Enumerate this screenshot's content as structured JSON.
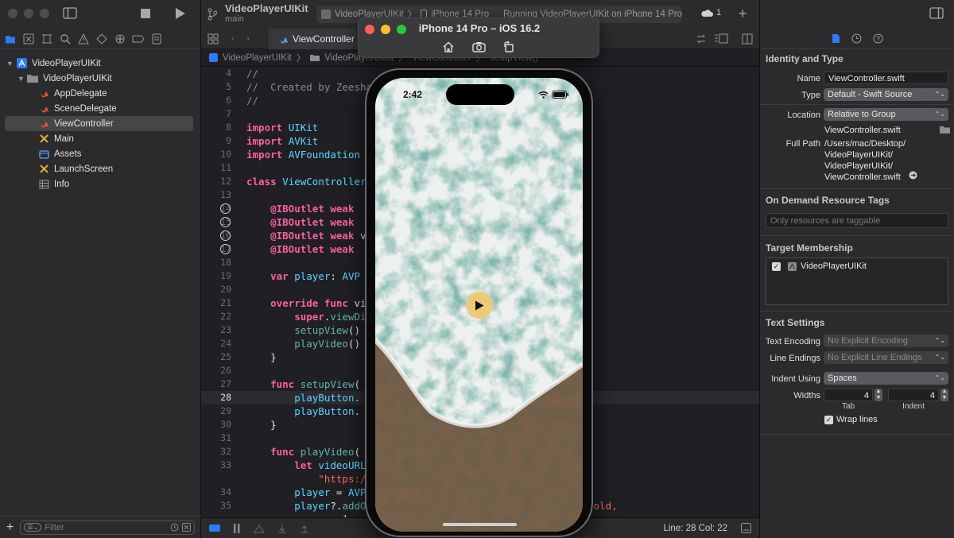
{
  "project": {
    "name": "VideoPlayerUIKit",
    "branch": "main"
  },
  "toolbar": {
    "scheme": "VideoPlayerUIKit",
    "destination": "iPhone 14 Pro",
    "status": "Running VideoPlayerUIKit on iPhone 14 Pro",
    "issues": "1"
  },
  "navigator": {
    "items": [
      {
        "label": "VideoPlayerUIKit",
        "icon": "project-icon"
      },
      {
        "label": "VideoPlayerUIKit",
        "icon": "folder-icon"
      },
      {
        "label": "AppDelegate",
        "icon": "swift-icon"
      },
      {
        "label": "SceneDelegate",
        "icon": "swift-icon"
      },
      {
        "label": "ViewController",
        "icon": "swift-icon"
      },
      {
        "label": "Main",
        "icon": "storyboard-icon"
      },
      {
        "label": "Assets",
        "icon": "assets-icon"
      },
      {
        "label": "LaunchScreen",
        "icon": "storyboard-icon"
      },
      {
        "label": "Info",
        "icon": "plist-icon"
      }
    ],
    "filter_placeholder": "Filter"
  },
  "editor": {
    "tab": "ViewController",
    "breadcrumb": [
      "VideoPlayerUIKit",
      "VideoPlayerUIKit",
      "ViewController",
      "setupView()"
    ],
    "lines": [
      {
        "n": "4",
        "text": "//"
      },
      {
        "n": "5",
        "text": "//  Created by Zeeshan"
      },
      {
        "n": "6",
        "text": "//"
      },
      {
        "n": "7",
        "text": ""
      },
      {
        "n": "8",
        "text": "import UIKit"
      },
      {
        "n": "9",
        "text": "import AVKit"
      },
      {
        "n": "10",
        "text": "import AVFoundation"
      },
      {
        "n": "11",
        "text": ""
      },
      {
        "n": "12",
        "text": "class ViewController"
      },
      {
        "n": "13",
        "text": ""
      },
      {
        "n": "14",
        "text": "    @IBOutlet weak"
      },
      {
        "n": "15",
        "text": "    @IBOutlet weak"
      },
      {
        "n": "16",
        "text": "    @IBOutlet weak v                              torView!"
      },
      {
        "n": "17",
        "text": "    @IBOutlet weak"
      },
      {
        "n": "18",
        "text": ""
      },
      {
        "n": "19",
        "text": "    var player: AVP"
      },
      {
        "n": "20",
        "text": ""
      },
      {
        "n": "21",
        "text": "    override func vi"
      },
      {
        "n": "22",
        "text": "        super.viewDi"
      },
      {
        "n": "23",
        "text": "        setupView()"
      },
      {
        "n": "24",
        "text": "        playVideo()"
      },
      {
        "n": "25",
        "text": "    }"
      },
      {
        "n": "26",
        "text": ""
      },
      {
        "n": "27",
        "text": "    func setupView("
      },
      {
        "n": "28",
        "text": "        playButton."
      },
      {
        "n": "29",
        "text": "        playButton."
      },
      {
        "n": "30",
        "text": "    }"
      },
      {
        "n": "31",
        "text": ""
      },
      {
        "n": "32",
        "text": "    func playVideo("
      },
      {
        "n": "33",
        "text": "        let videoURL"
      },
      {
        "n": "",
        "text": "            \"https:/                         deos.mp4\")"
      },
      {
        "n": "34",
        "text": "        player = AVP"
      },
      {
        "n": "35",
        "text": "        player?.addO                  Status\", options: [.old,"
      },
      {
        "n": "",
        "text": "            .new], c"
      }
    ],
    "status": {
      "line_col": "Line: 28  Col: 22"
    }
  },
  "simulator": {
    "title": "iPhone 14 Pro – iOS 16.2",
    "time": "2:42"
  },
  "inspector": {
    "identity_title": "Identity and Type",
    "name_label": "Name",
    "name_value": "ViewController.swift",
    "type_label": "Type",
    "type_value": "Default - Swift Source",
    "location_label": "Location",
    "location_value": "Relative to Group",
    "location_file": "ViewController.swift",
    "fullpath_label": "Full Path",
    "fullpath_lines": [
      "/Users/mac/Desktop/",
      "VideoPlayerUIKit/",
      "VideoPlayerUIKit/",
      "ViewController.swift"
    ],
    "ondemand_title": "On Demand Resource Tags",
    "ondemand_placeholder": "Only resources are taggable",
    "target_title": "Target Membership",
    "target_item": "VideoPlayerUIKit",
    "text_title": "Text Settings",
    "encoding_label": "Text Encoding",
    "encoding_value": "No Explicit Encoding",
    "endings_label": "Line Endings",
    "endings_value": "No Explicit Line Endings",
    "indent_label": "Indent Using",
    "indent_value": "Spaces",
    "widths_label": "Widths",
    "tab_width": "4",
    "indent_width": "4",
    "tab_caption": "Tab",
    "indent_caption": "Indent",
    "wrap_label": "Wrap lines"
  },
  "colors": {
    "accent": "#2f7bf6",
    "swift": "#f05138",
    "keyword": "#fc5fa3",
    "type": "#5dd8ff"
  }
}
